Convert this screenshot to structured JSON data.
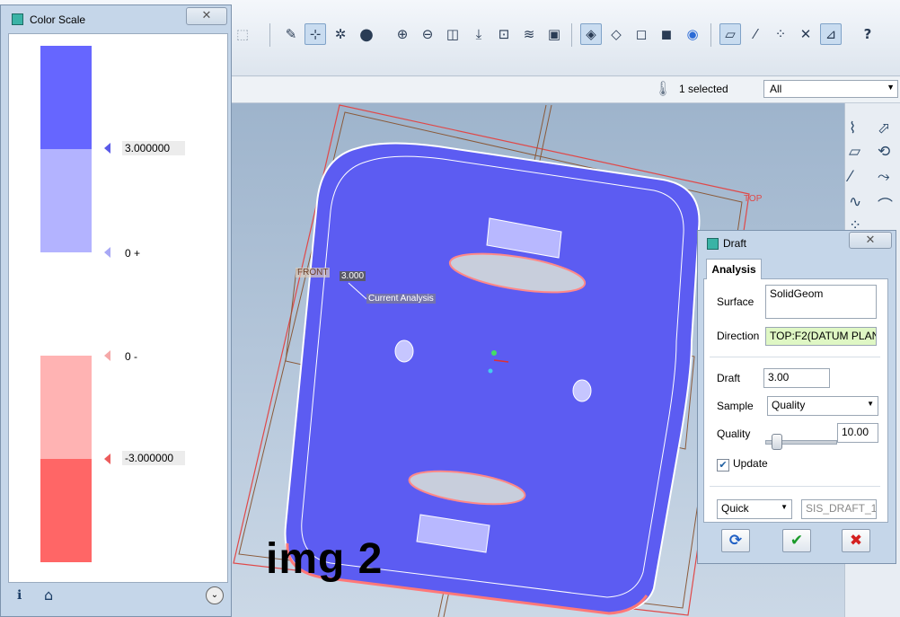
{
  "toolbar": {
    "icons": [
      "select-box-icon",
      "sketch-icon",
      "datum-display-icon",
      "spin-center-icon",
      "shaded-sphere-icon",
      "zoom-in-icon",
      "zoom-out-icon",
      "refit-icon",
      "reorient-icon",
      "annotation-display-icon",
      "layers-icon",
      "saved-views-icon",
      "shaded-icon",
      "wireframe-icon",
      "hidden-line-icon",
      "no-hidden-icon",
      "appearance-icon",
      "datum-planes-icon",
      "datum-axes-icon",
      "datum-points-icon",
      "coord-sys-icon",
      "help-icon"
    ]
  },
  "filter_bar": {
    "selected_count": "1 selected",
    "filter_value": "All"
  },
  "color_scale": {
    "title": "Color Scale",
    "close_glyph": "✕",
    "swatches": [
      "#6666ff",
      "#b3b3ff",
      "#ffffff",
      "#ffb3b3",
      "#ff6666"
    ],
    "labels": [
      "3.000000",
      "0 +",
      "0 -",
      "-3.000000"
    ],
    "marker_colors": [
      "#5a5ae8",
      "#a8a8f5",
      "#f5a8a8",
      "#ec5c5c"
    ],
    "footer": {
      "info_glyph": "ℹ",
      "home_glyph": "⌂",
      "expand_glyph": "⌄"
    }
  },
  "viewport": {
    "datum_labels": {
      "front": "FRONT",
      "top": "TOP"
    },
    "analysis_value": "3.000",
    "analysis_name": "Current Analysis",
    "colors": {
      "part": "#5c5cf2",
      "negative_edge": "#ff7878",
      "datum_red": "#e04848",
      "datum_brown": "#8a5a3a",
      "background_top": "#9eb4cc"
    }
  },
  "watermark": "img 2",
  "draft_dialog": {
    "title": "Draft",
    "tab": "Analysis",
    "surface_label": "Surface",
    "surface_value": "SolidGeom",
    "direction_label": "Direction",
    "direction_value": "TOP:F2(DATUM PLAN",
    "draft_label": "Draft",
    "draft_value": "3.00",
    "sample_label": "Sample",
    "sample_value": "Quality",
    "quality_label": "Quality",
    "quality_value": "10.00",
    "quality_level": 0.1,
    "update_label": "Update",
    "update_checked": true,
    "mode_value": "Quick",
    "name_value": "SIS_DRAFT_1",
    "buttons": {
      "repeat_glyph": "⟳",
      "ok_glyph": "✔",
      "cancel_glyph": "✖"
    }
  }
}
